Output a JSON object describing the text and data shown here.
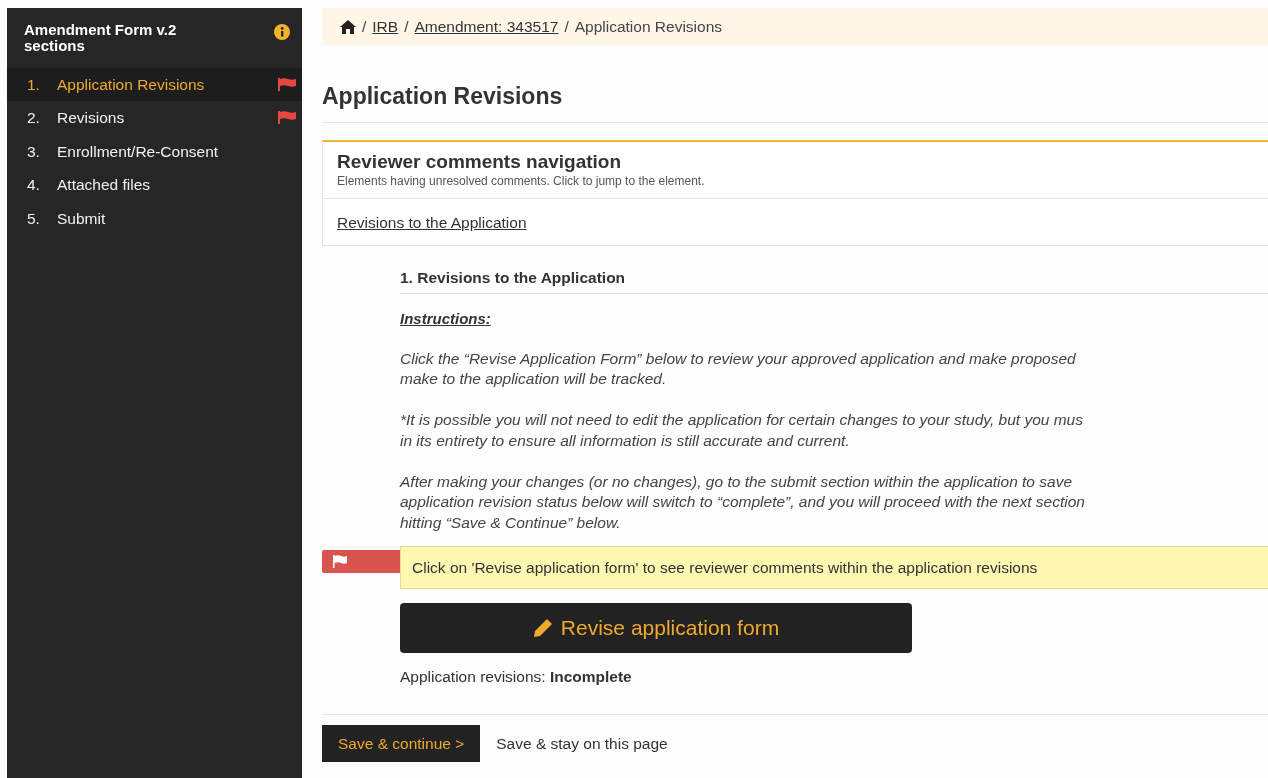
{
  "sidebar": {
    "title": "Amendment Form v.2 sections",
    "items": [
      {
        "number": "1.",
        "label": "Application Revisions",
        "selected": true,
        "flagged": true
      },
      {
        "number": "2.",
        "label": "Revisions",
        "selected": false,
        "flagged": true
      },
      {
        "number": "3.",
        "label": "Enrollment/Re-Consent",
        "selected": false,
        "flagged": false
      },
      {
        "number": "4.",
        "label": "Attached files",
        "selected": false,
        "flagged": false
      },
      {
        "number": "5.",
        "label": "Submit",
        "selected": false,
        "flagged": false
      }
    ]
  },
  "breadcrumb": [
    {
      "separator": "/",
      "label": "IRB",
      "kind": "link"
    },
    {
      "separator": "/",
      "label": "Amendment: 343517",
      "kind": "link"
    },
    {
      "separator": "/",
      "label": "Application Revisions",
      "kind": "current"
    }
  ],
  "page_title": "Application Revisions",
  "comments_nav": {
    "title": "Reviewer comments navigation",
    "subtitle": "Elements having unresolved comments. Click to jump to the element.",
    "links": [
      "Revisions to the Application"
    ]
  },
  "question": {
    "title": "1. Revisions to the Application",
    "instructions_label": "Instructions:",
    "paragraphs": [
      [
        "Click the “Revise Application Form” below to review your approved application and make proposed",
        "make to the application will be tracked."
      ],
      [
        "*It is possible you will not need to edit the application for certain changes to your study, but you mus",
        "in its entirety to ensure all information is still accurate and current."
      ],
      [
        "After making your changes (or no changes), go to the submit section within the application to save",
        "application revision status below will switch to “complete”, and you will proceed with the next section",
        "hitting “Save & Continue” below."
      ]
    ],
    "alert": "Click on 'Revise application form' to see reviewer comments within the application revisions",
    "button": "Revise application form",
    "status": "Application revisions: **Incomplete**"
  },
  "footer_buttons": [
    {
      "label": "Save & continue >",
      "kind": "primary"
    },
    {
      "label": "Save & stay on this page",
      "kind": "plain"
    }
  ]
}
